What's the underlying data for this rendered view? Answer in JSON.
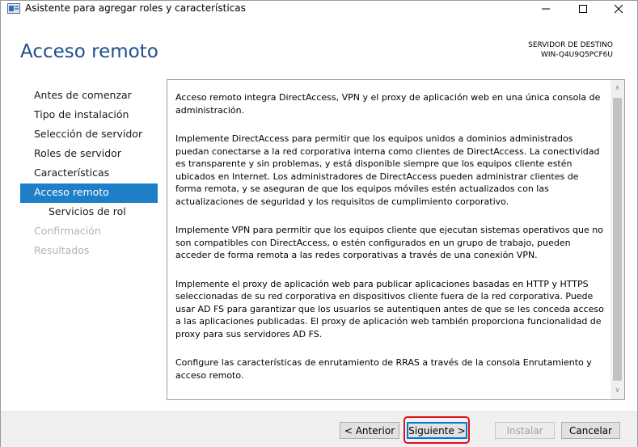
{
  "window": {
    "title": "Asistente para agregar roles y características",
    "icon": "server-manager-icon"
  },
  "header": {
    "title": "Acceso remoto",
    "dest_label": "SERVIDOR DE DESTINO",
    "dest_server": "WIN-Q4U9Q5PCF6U"
  },
  "nav": {
    "items": [
      {
        "label": "Antes de comenzar"
      },
      {
        "label": "Tipo de instalación"
      },
      {
        "label": "Selección de servidor"
      },
      {
        "label": "Roles de servidor"
      },
      {
        "label": "Características"
      },
      {
        "label": "Acceso remoto"
      },
      {
        "label": "Servicios de rol"
      },
      {
        "label": "Confirmación"
      },
      {
        "label": "Resultados"
      }
    ]
  },
  "content": {
    "paragraphs": [
      "Acceso remoto integra DirectAccess, VPN y el proxy de aplicación web en una única consola de administración.",
      "Implemente DirectAccess para permitir que los equipos unidos a dominios administrados puedan conectarse a la red corporativa interna como clientes de DirectAccess. La conectividad es transparente y sin problemas, y está disponible siempre que los equipos cliente estén ubicados en Internet. Los administradores de DirectAccess pueden administrar clientes de forma remota, y se aseguran de que los equipos móviles estén actualizados con las actualizaciones de seguridad y los requisitos de cumplimiento corporativo.",
      "Implemente VPN para permitir que los equipos cliente que ejecutan sistemas operativos que no son compatibles con DirectAccess, o estén configurados en un grupo de trabajo, pueden acceder de forma remota a las redes corporativas a través de una conexión VPN.",
      "Implemente el proxy de aplicación web para publicar aplicaciones basadas en HTTP y HTTPS seleccionadas de su red corporativa en dispositivos cliente fuera de la red corporativa. Puede usar AD FS para garantizar que los usuarios se autentiquen antes de que se les conceda acceso a las aplicaciones publicadas. El proxy de aplicación web también proporciona funcionalidad de proxy para sus servidores AD FS.",
      "Configure las características de enrutamiento de RRAS a través de la consola Enrutamiento y acceso remoto."
    ]
  },
  "footer": {
    "prev": "< Anterior",
    "next": "Siguiente >",
    "install": "Instalar",
    "cancel": "Cancelar"
  },
  "colors": {
    "accent": "#1e7fc8",
    "title": "#1e4e8c",
    "highlight": "#e0101a"
  }
}
